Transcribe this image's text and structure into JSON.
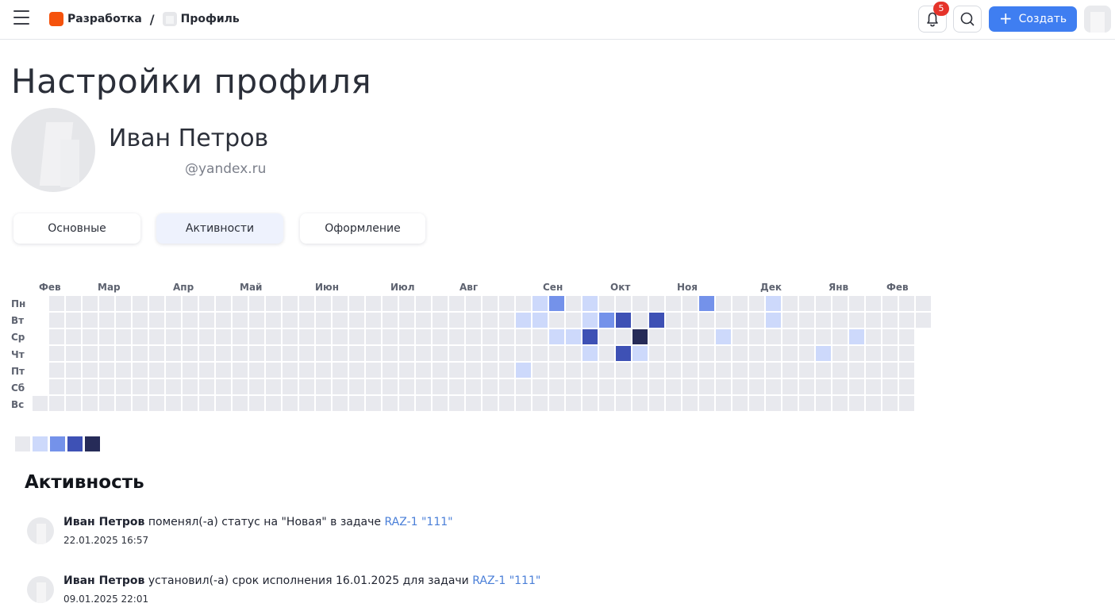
{
  "header": {
    "breadcrumbs": [
      "Разработка",
      "Профиль"
    ],
    "separator": "/",
    "notifications_count": "5",
    "create_label": "Создать"
  },
  "page_title": "Настройки профиля",
  "profile": {
    "name": "Иван Петров",
    "email": "@yandex.ru"
  },
  "tabs": [
    {
      "label": "Основные",
      "active": false
    },
    {
      "label": "Активности",
      "active": true
    },
    {
      "label": "Оформление",
      "active": false
    }
  ],
  "heatmap": {
    "months": [
      "Фев",
      "Мар",
      "Апр",
      "Май",
      "Июн",
      "Июл",
      "Авг",
      "Сен",
      "Окт",
      "Ноя",
      "Дек",
      "Янв",
      "Фев"
    ],
    "days": [
      "Пн",
      "Вт",
      "Ср",
      "Чт",
      "Пт",
      "Сб",
      "Вс"
    ],
    "levels": [
      "#e8e9ee",
      "#cdd9fb",
      "#7492ea",
      "#3e51b5",
      "#262b58"
    ],
    "active_cells": [
      {
        "week": 30,
        "day": 0,
        "level": 1
      },
      {
        "week": 31,
        "day": 0,
        "level": 2
      },
      {
        "week": 33,
        "day": 0,
        "level": 1
      },
      {
        "week": 40,
        "day": 0,
        "level": 2
      },
      {
        "week": 44,
        "day": 0,
        "level": 1
      },
      {
        "week": 29,
        "day": 1,
        "level": 1
      },
      {
        "week": 30,
        "day": 1,
        "level": 1
      },
      {
        "week": 33,
        "day": 1,
        "level": 1
      },
      {
        "week": 34,
        "day": 1,
        "level": 2
      },
      {
        "week": 35,
        "day": 1,
        "level": 3
      },
      {
        "week": 37,
        "day": 1,
        "level": 3
      },
      {
        "week": 44,
        "day": 1,
        "level": 1
      },
      {
        "week": 31,
        "day": 2,
        "level": 1
      },
      {
        "week": 32,
        "day": 2,
        "level": 1
      },
      {
        "week": 33,
        "day": 2,
        "level": 3
      },
      {
        "week": 36,
        "day": 2,
        "level": 4
      },
      {
        "week": 41,
        "day": 2,
        "level": 1
      },
      {
        "week": 49,
        "day": 2,
        "level": 1
      },
      {
        "week": 33,
        "day": 3,
        "level": 1
      },
      {
        "week": 35,
        "day": 3,
        "level": 3
      },
      {
        "week": 36,
        "day": 3,
        "level": 1
      },
      {
        "week": 47,
        "day": 3,
        "level": 1
      },
      {
        "week": 29,
        "day": 4,
        "level": 1
      }
    ]
  },
  "activity": {
    "title": "Активность",
    "items": [
      {
        "user": "Иван Петров",
        "action": " поменял(-а) статус на \"Новая\" в задаче ",
        "link": "RAZ-1 \"111\"",
        "time": "22.01.2025 16:57"
      },
      {
        "user": "Иван Петров",
        "action": " установил(-а) срок исполнения 16.01.2025 для задачи ",
        "link": "RAZ-1 \"111\"",
        "time": "09.01.2025 22:01"
      }
    ]
  },
  "icons": [
    "menu-icon",
    "project-icon",
    "page-icon",
    "bell-icon",
    "search-icon",
    "plus-icon"
  ]
}
